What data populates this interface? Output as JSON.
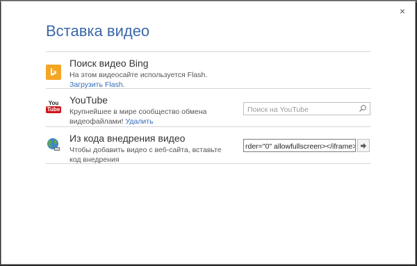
{
  "dialog": {
    "title": "Вставка видео",
    "close_glyph": "×"
  },
  "rows": [
    {
      "icon": "bing-icon",
      "title": "Поиск видео Bing",
      "description": "На этом видеосайте используется Flash.",
      "link": "Загрузить Flash."
    },
    {
      "icon": "youtube-icon",
      "icon_text_top": "You",
      "icon_text_bottom": "Tube",
      "title": "YouTube",
      "description": "Крупнейшее в мире сообщество обмена видеофайлами!",
      "link": "Удалить",
      "search_placeholder": "Поиск на YouTube"
    },
    {
      "icon": "globe-icon",
      "title": "Из кода внедрения видео",
      "description": "Чтобы добавить видео с веб-сайта, вставьте код внедрения",
      "input_value": "rder=\"0\" allowfullscreen></iframe>"
    }
  ],
  "colors": {
    "title": "#3b67a8",
    "link": "#2f6bb8",
    "bing": "#f5a623",
    "youtube_red": "#cc181e"
  }
}
